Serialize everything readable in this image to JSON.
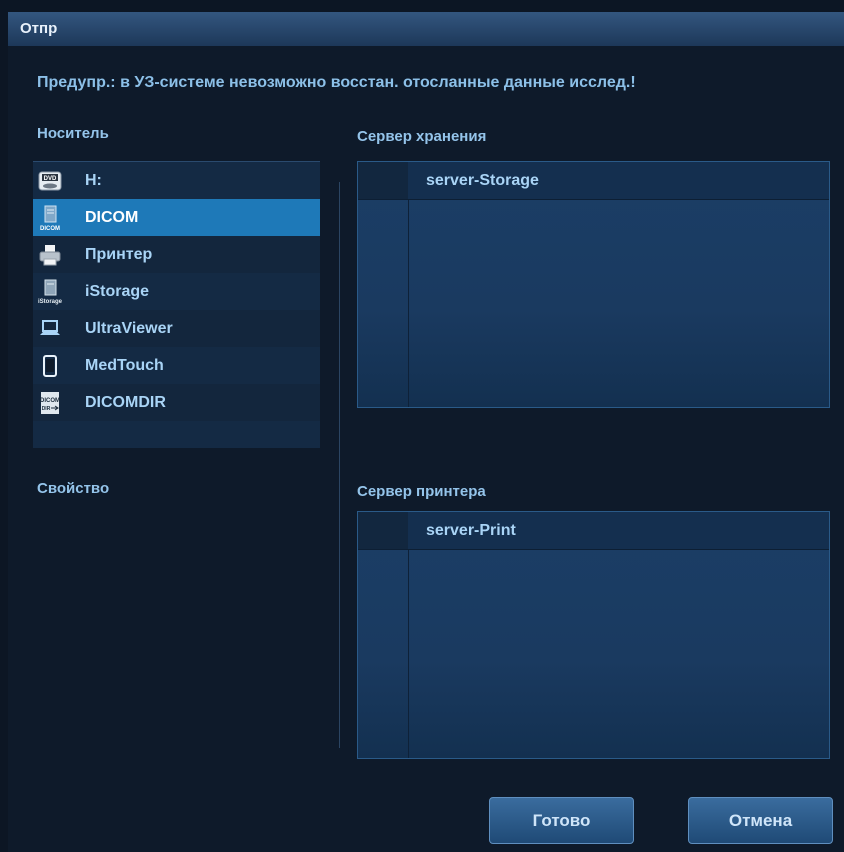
{
  "dialog": {
    "title": "Отпр",
    "warning": "Предупр.: в УЗ-системе невозможно восстан. отосланные данные исслед.!"
  },
  "media": {
    "label": "Носитель",
    "items": [
      {
        "label": "H:",
        "icon": "dvd-drive-icon"
      },
      {
        "label": "DICOM",
        "icon": "dicom-icon",
        "selected": true
      },
      {
        "label": "Принтер",
        "icon": "printer-icon"
      },
      {
        "label": "iStorage",
        "icon": "istorage-icon"
      },
      {
        "label": "UltraViewer",
        "icon": "laptop-icon"
      },
      {
        "label": "MedTouch",
        "icon": "tablet-icon"
      },
      {
        "label": "DICOMDIR",
        "icon": "dicomdir-icon"
      }
    ]
  },
  "property": {
    "label": "Свойство"
  },
  "storage_server": {
    "label": "Сервер хранения",
    "items": [
      "server-Storage"
    ]
  },
  "printer_server": {
    "label": "Сервер принтера",
    "items": [
      "server-Print"
    ]
  },
  "buttons": {
    "done": "Готово",
    "cancel": "Отмена"
  }
}
